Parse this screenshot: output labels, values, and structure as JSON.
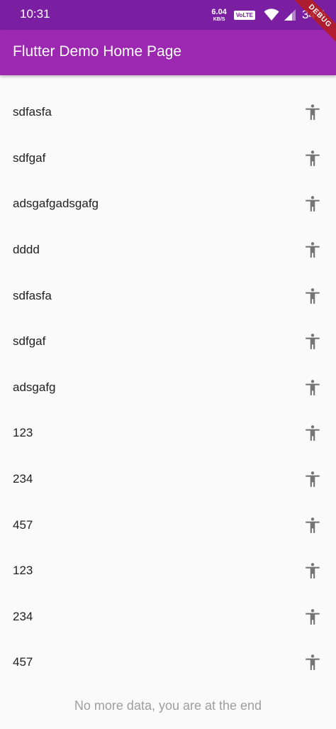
{
  "status_bar": {
    "time": "10:31",
    "net_speed_value": "6.04",
    "net_speed_unit": "KB/S",
    "network_badge": "VoLTE",
    "battery": "34%"
  },
  "app_bar": {
    "title": "Flutter Demo Home Page"
  },
  "debug_banner": {
    "label": "DEBUG"
  },
  "list": {
    "icon": "accessibility-icon",
    "items": [
      {
        "label": "sdfasfa"
      },
      {
        "label": "sdfgaf"
      },
      {
        "label": "adsgafgadsgafg"
      },
      {
        "label": "dddd"
      },
      {
        "label": "sdfasfa"
      },
      {
        "label": "sdfgaf"
      },
      {
        "label": "adsgafg"
      },
      {
        "label": "123"
      },
      {
        "label": "234"
      },
      {
        "label": "457"
      },
      {
        "label": "123"
      },
      {
        "label": "234"
      },
      {
        "label": "457"
      }
    ]
  },
  "footer": {
    "end_message": "No more data, you are at the end"
  },
  "colors": {
    "status_bar": "#7b1fa2",
    "app_bar": "#9c27b0",
    "background": "#fafafa",
    "icon": "#757575",
    "text": "#212121",
    "muted_text": "#9e9e9e"
  }
}
